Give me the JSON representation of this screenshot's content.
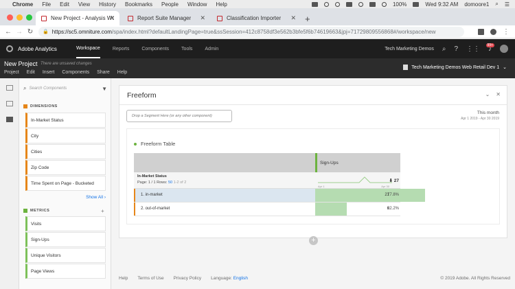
{
  "mac_menubar": {
    "app": "Chrome",
    "menus": [
      "File",
      "Edit",
      "View",
      "History",
      "Bookmarks",
      "People",
      "Window",
      "Help"
    ],
    "battery": "100%",
    "clock": "Wed 9:32 AM",
    "user": "domoore1"
  },
  "browser": {
    "tabs": [
      {
        "label": "New Project - Analysis Workspa",
        "active": true
      },
      {
        "label": "Report Suite Manager",
        "active": false
      },
      {
        "label": "Classification Importer",
        "active": false
      }
    ],
    "url_host": "https://sc5.omniture.com",
    "url_path": "/spa/index.html?defaultLandingPage=true&ssSession=412c8758df3e562b3bfe5f6b74619663&jpj=71729809556868#/workspace/new"
  },
  "app": {
    "brand": "Adobe Analytics",
    "nav": [
      "Workspace",
      "Reports",
      "Components",
      "Tools",
      "Admin"
    ],
    "active_nav": "Workspace",
    "company": "Tech Marketing Demos",
    "notification_count": "99+"
  },
  "project": {
    "title": "New Project",
    "unsaved_note": "There are unsaved changes",
    "menu": [
      "Project",
      "Edit",
      "Insert",
      "Components",
      "Share",
      "Help"
    ],
    "report_suite": "Tech Marketing Demos Web Retail Dev 1"
  },
  "components_panel": {
    "search_placeholder": "Search Components",
    "dimensions_heading": "DIMENSIONS",
    "dimensions": [
      "In-Market Status",
      "City",
      "Cities",
      "Zip Code",
      "Time Spent on Page - Bucketed"
    ],
    "show_all": "Show All",
    "metrics_heading": "METRICS",
    "metrics": [
      "Visits",
      "Sign-Ups",
      "Unique Visitors",
      "Page Views"
    ]
  },
  "freeform_panel": {
    "title": "Freeform",
    "drop_zone": "Drop a Segment Here (or any other component)",
    "date_label": "This month",
    "date_range": "Apr 1 2019 - Apr 30 2019",
    "viz_title": "Freeform Table",
    "metric_column": "Sign-Ups",
    "dimension_title": "In-Market Status",
    "pager_prefix": "Page: 1 / 1  Rows: ",
    "rows_per_page": "50",
    "row_range": "1-2 of 2",
    "axis_start": "Apr 1",
    "axis_end": "Apr 30",
    "total": "27",
    "rows": [
      {
        "label": "1. in-market",
        "value": "21",
        "pct": "77.8%",
        "share": 0.778,
        "selected": true
      },
      {
        "label": "2. out-of-market",
        "value": "6",
        "pct": "22.2%",
        "share": 0.222,
        "selected": false
      }
    ]
  },
  "footer": {
    "links": [
      "Help",
      "Terms of Use",
      "Privacy Policy"
    ],
    "language_label": "Language:",
    "language_value": "English",
    "copyright": "© 2019 Adobe. All Rights Reserved"
  },
  "colors": {
    "dimension_accent": "#e68619",
    "metric_accent": "#6cb33f",
    "link": "#1473e6",
    "topnav_bg": "#1e1e1e"
  },
  "icons": [
    "apple-icon",
    "search-icon",
    "help-icon",
    "apps-grid-icon",
    "bell-icon",
    "filter-icon",
    "close-icon",
    "chevron-down-icon",
    "add-panel-icon",
    "sort-down-icon"
  ]
}
